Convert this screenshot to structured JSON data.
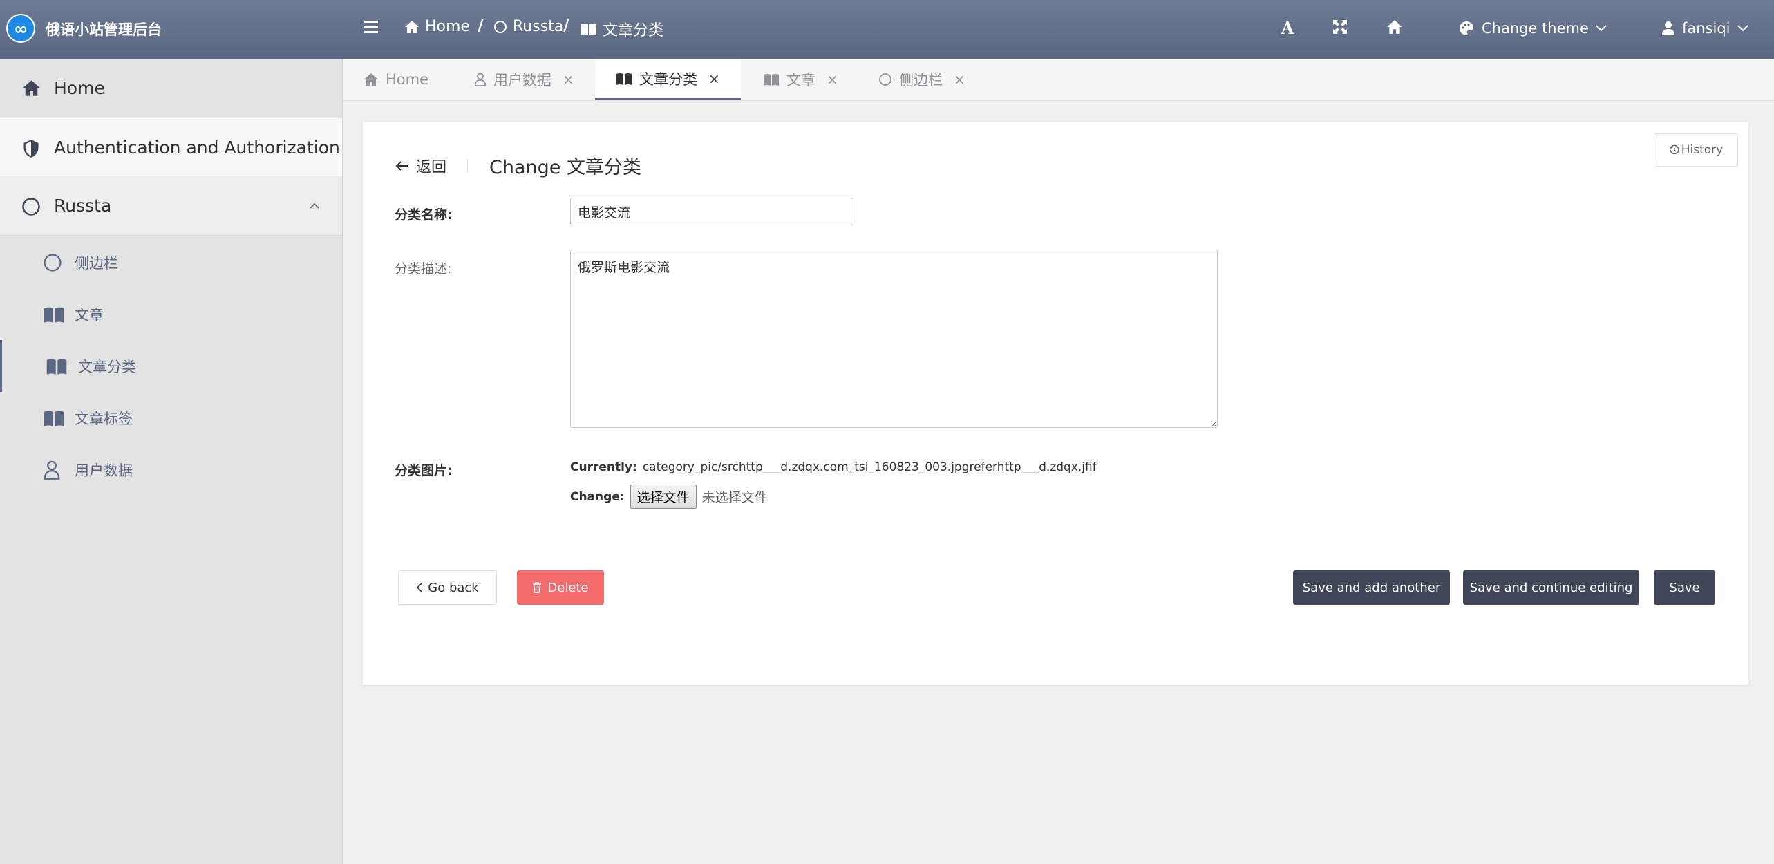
{
  "app": {
    "brand": "俄语小站管理后台"
  },
  "header": {
    "breadcrumb": [
      {
        "label": "Home",
        "icon": "home-icon"
      },
      {
        "label": "Russta",
        "icon": "circle-icon"
      },
      {
        "label": "文章分类",
        "icon": "book-icon"
      }
    ],
    "breadcrumb_sep": "/",
    "change_theme": "Change theme",
    "username": "fansiqi"
  },
  "sidebar": {
    "items": [
      {
        "label": "Home",
        "icon": "home-icon"
      },
      {
        "label": "Authentication and Authorization",
        "icon": "shield-icon"
      },
      {
        "label": "Russta",
        "icon": "circle-icon"
      }
    ],
    "subitems": [
      {
        "label": "侧边栏",
        "icon": "circle-icon"
      },
      {
        "label": "文章",
        "icon": "book-icon"
      },
      {
        "label": "文章分类",
        "icon": "book-icon",
        "active": true
      },
      {
        "label": "文章标签",
        "icon": "book-icon"
      },
      {
        "label": "用户数据",
        "icon": "user-icon"
      }
    ]
  },
  "tabs": [
    {
      "label": "Home",
      "icon": "home-icon"
    },
    {
      "label": "用户数据",
      "icon": "user-icon"
    },
    {
      "label": "文章分类",
      "icon": "book-icon",
      "active": true
    },
    {
      "label": "文章",
      "icon": "book-icon"
    },
    {
      "label": "侧边栏",
      "icon": "circle-icon"
    }
  ],
  "tab_close": "×",
  "page": {
    "back_label": "返回",
    "title": "Change 文章分类",
    "history": "History"
  },
  "form": {
    "name_label": "分类名称:",
    "name_value": "电影交流",
    "desc_label": "分类描述:",
    "desc_value": "俄罗斯电影交流",
    "image_label": "分类图片:",
    "currently_label": "Currently:",
    "currently_value": "category_pic/srchttp___d.zdqx.com_tsl_160823_003.jpgreferhttp___d.zdqx.jfif",
    "change_label": "Change:",
    "choose_file": "选择文件",
    "no_file": "未选择文件"
  },
  "actions": {
    "go_back": "Go back",
    "delete": "Delete",
    "save_add": "Save and add another",
    "save_continue": "Save and continue editing",
    "save": "Save"
  },
  "colors": {
    "header": "#5b6782",
    "sidebar_bg": "#e3e3e3",
    "accent": "#5b6782",
    "danger": "#f56c6c",
    "dark_button": "#3f4657"
  }
}
